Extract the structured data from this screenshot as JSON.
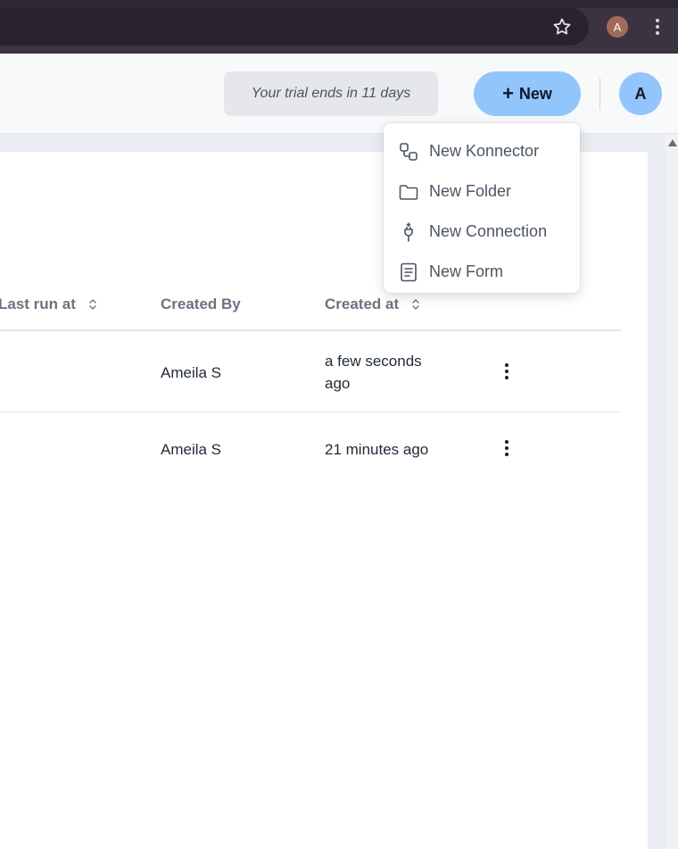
{
  "browser": {
    "profile_initial": "A",
    "icons": {
      "star": "star-icon",
      "menu": "kebab-icon"
    }
  },
  "header": {
    "trial_text": "Your trial ends in 11 days",
    "new_button_label": "New",
    "user_initial": "A",
    "accent_color": "#93c5fd"
  },
  "table": {
    "columns": [
      {
        "label": "Last run at",
        "sortable": true
      },
      {
        "label": "Created By",
        "sortable": false
      },
      {
        "label": "Created at",
        "sortable": true
      }
    ],
    "rows": [
      {
        "created_by": "Ameila S",
        "created_at": "a few seconds ago"
      },
      {
        "created_by": "Ameila S",
        "created_at": "21 minutes ago"
      }
    ]
  },
  "new_menu": {
    "items": [
      {
        "label": "New Konnector",
        "icon": "konnector-icon"
      },
      {
        "label": "New Folder",
        "icon": "folder-icon"
      },
      {
        "label": "New Connection",
        "icon": "plug-icon"
      },
      {
        "label": "New Form",
        "icon": "form-icon"
      }
    ]
  }
}
